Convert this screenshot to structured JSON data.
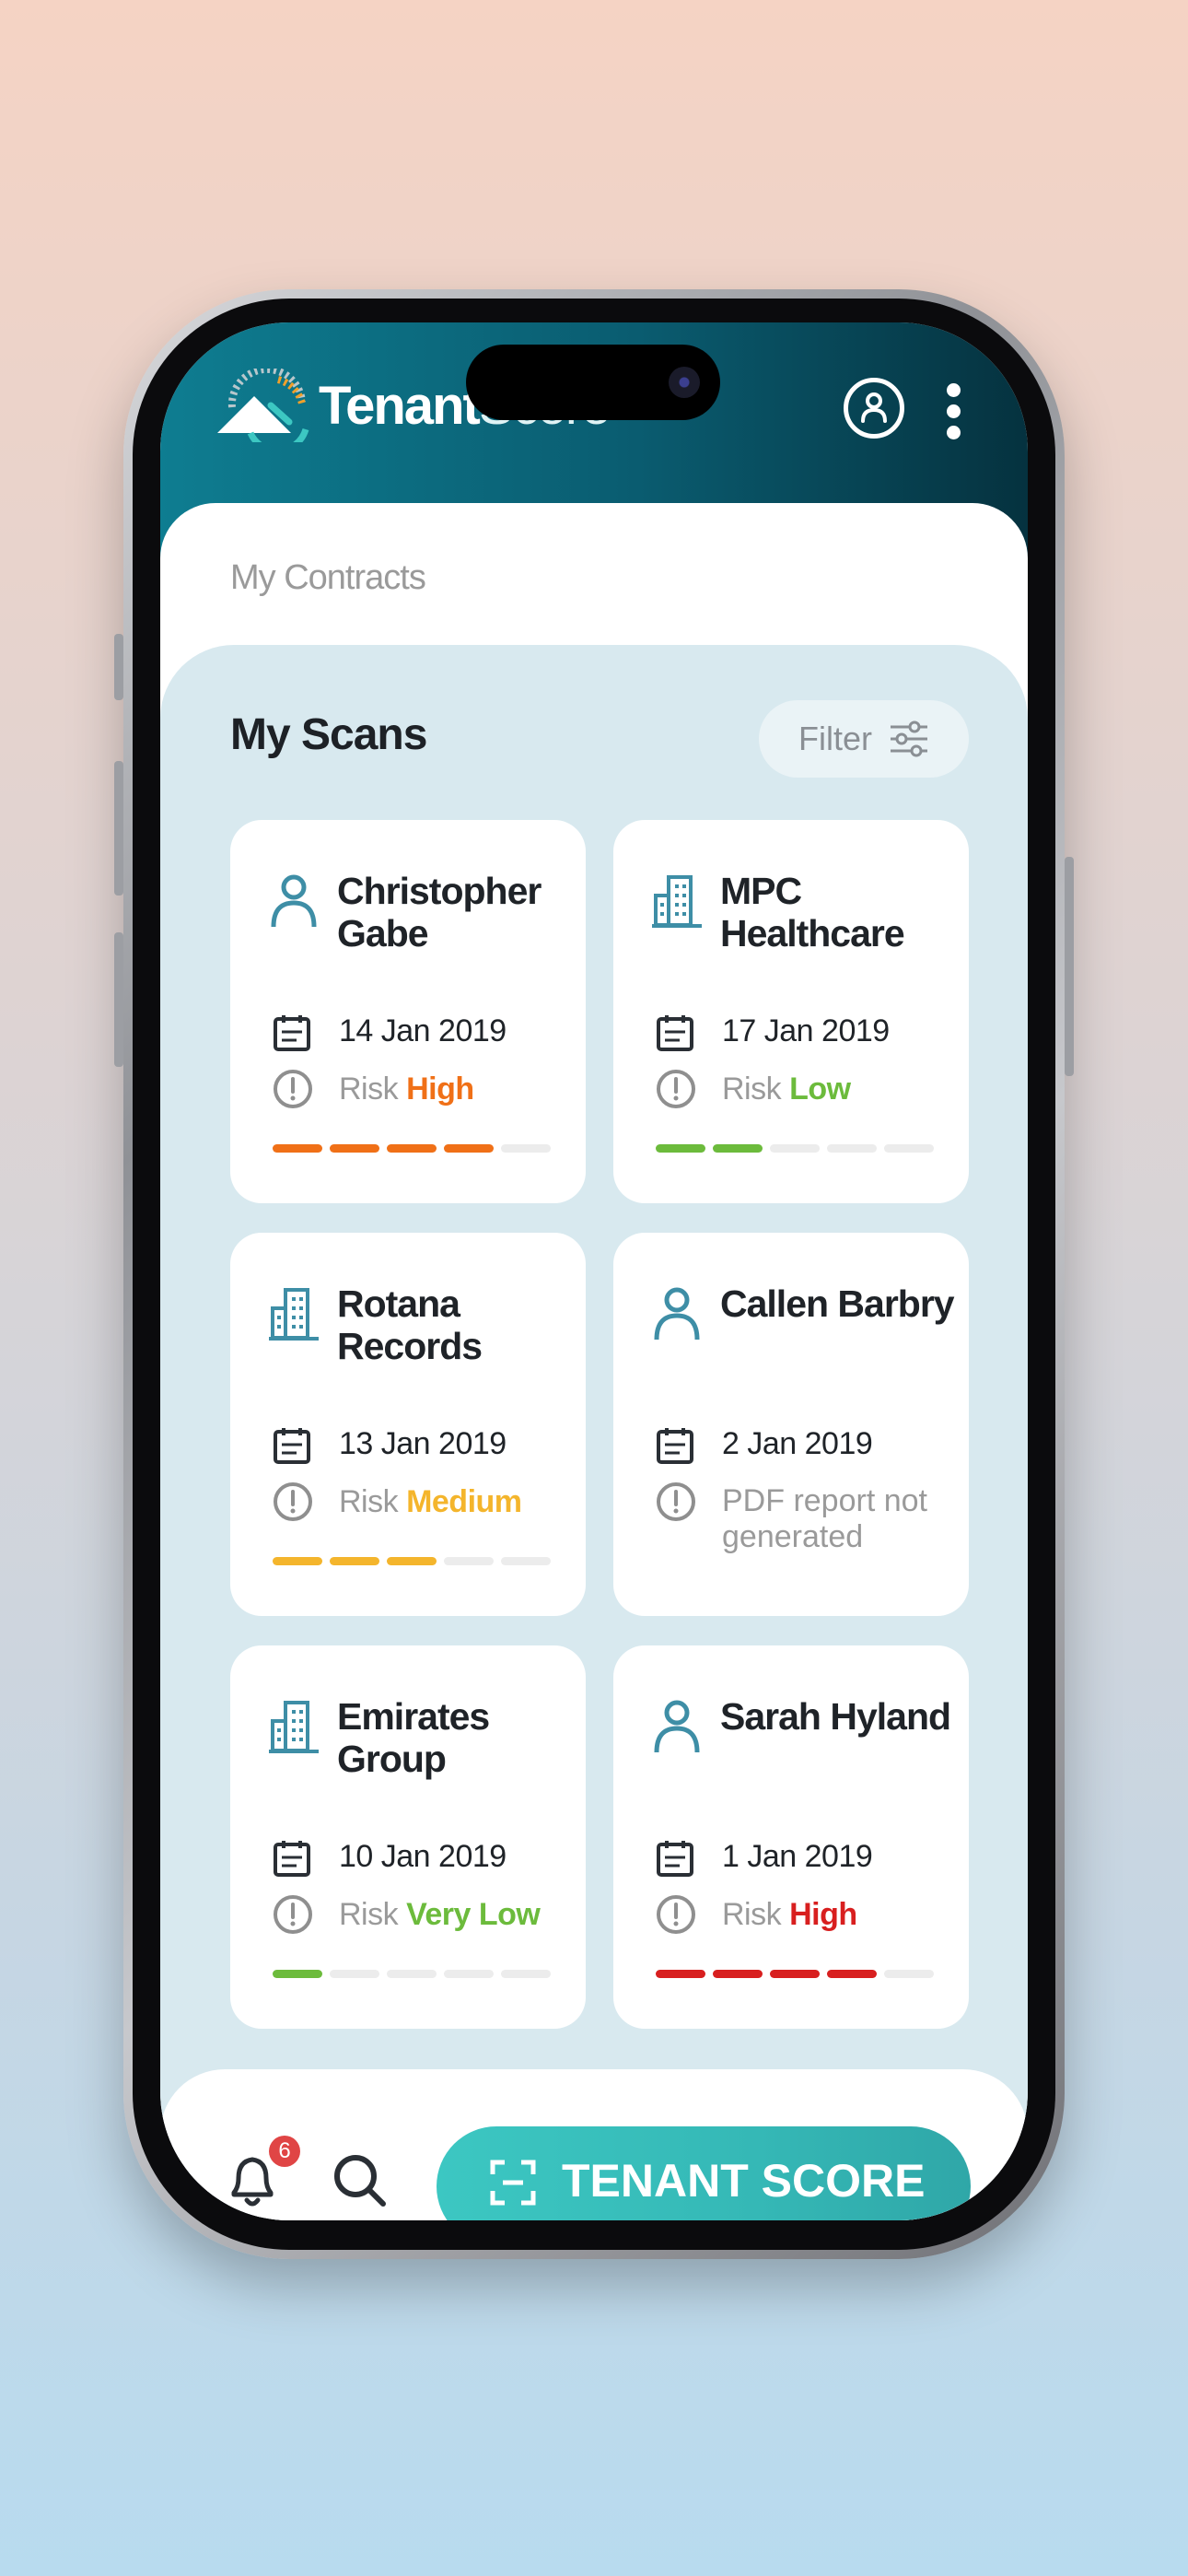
{
  "header": {
    "brand_bold": "Tenant",
    "brand_light": "Score"
  },
  "contracts": {
    "title": "My Contracts"
  },
  "scans": {
    "title": "My Scans",
    "filter_label": "Filter",
    "cards": [
      {
        "name": "Christopher Gabe",
        "type_icon": "person-icon",
        "date": "14 Jan 2019",
        "risk_prefix": "Risk",
        "risk_level": "High",
        "risk_color": "#f07017",
        "risk_segments": 4
      },
      {
        "name": "MPC Healthcare",
        "type_icon": "building-icon",
        "date": "17 Jan 2019",
        "risk_prefix": "Risk",
        "risk_level": "Low",
        "risk_color": "#6cbb3c",
        "risk_segments": 2
      },
      {
        "name": "Rotana Records",
        "type_icon": "building-icon",
        "date": "13 Jan 2019",
        "risk_prefix": "Risk",
        "risk_level": "Medium",
        "risk_color": "#f4b52c",
        "risk_segments": 3
      },
      {
        "name": "Callen Barbry",
        "type_icon": "person-icon",
        "date": "2 Jan 2019",
        "status_note": "PDF report not generated"
      },
      {
        "name": "Emirates Group",
        "type_icon": "building-icon",
        "date": "10 Jan 2019",
        "risk_prefix": "Risk",
        "risk_level": "Very Low",
        "risk_color": "#6cbb3c",
        "risk_segments": 1
      },
      {
        "name": "Sarah Hyland",
        "type_icon": "person-icon",
        "date": "1 Jan 2019",
        "risk_prefix": "Risk",
        "risk_level": "High",
        "risk_color": "#d81f1f",
        "risk_segments": 4
      }
    ]
  },
  "bottom_nav": {
    "notification_count": "6",
    "cta_label": "TENANT SCORE"
  },
  "colors": {
    "header_start": "#0e7d91",
    "header_end": "#05323f",
    "icon_teal": "#3e8ea6",
    "cta": "#3cc7c2",
    "badge": "#e04545"
  }
}
